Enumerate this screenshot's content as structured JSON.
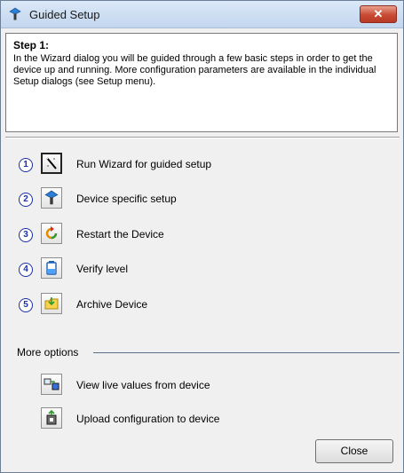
{
  "window": {
    "title": "Guided Setup",
    "close_glyph": "✕"
  },
  "info": {
    "heading": "Step 1:",
    "body": "In the Wizard dialog you will be guided through a few basic steps in order to get the device up and running. More configuration parameters are available in the individual Setup dialogs (see Setup menu)."
  },
  "steps": [
    {
      "num": "1",
      "label": "Run Wizard for guided setup",
      "icon": "wand-icon"
    },
    {
      "num": "2",
      "label": "Device specific setup",
      "icon": "device-icon"
    },
    {
      "num": "3",
      "label": "Restart the Device",
      "icon": "restart-icon"
    },
    {
      "num": "4",
      "label": "Verify level",
      "icon": "tank-icon"
    },
    {
      "num": "5",
      "label": "Archive Device",
      "icon": "archive-folder-icon"
    }
  ],
  "more_options": {
    "label": "More options",
    "items": [
      {
        "label": "View live values from device",
        "icon": "live-values-icon"
      },
      {
        "label": "Upload configuration to device",
        "icon": "upload-icon"
      }
    ]
  },
  "buttons": {
    "close": "Close"
  },
  "colors": {
    "step_number": "#1a2fa8",
    "title_close": "#c84a33"
  }
}
